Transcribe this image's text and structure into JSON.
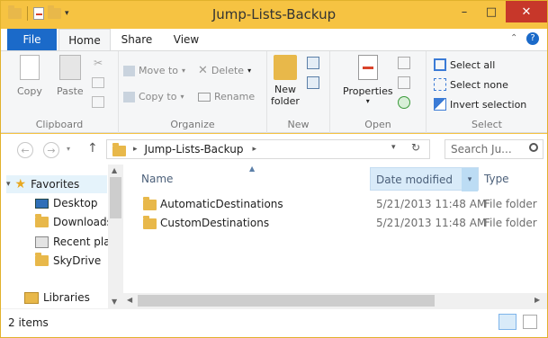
{
  "window": {
    "title": "Jump-Lists-Backup",
    "accent": "#f6c342"
  },
  "window_controls": {
    "minimize": "–",
    "maximize": "□",
    "close": "✕"
  },
  "ribbon_tabs": [
    {
      "label": "File"
    },
    {
      "label": "Home"
    },
    {
      "label": "Share"
    },
    {
      "label": "View"
    }
  ],
  "ribbon": {
    "clipboard": {
      "copy": "Copy",
      "paste": "Paste",
      "label": "Clipboard"
    },
    "organize": {
      "move_to": "Move to",
      "copy_to": "Copy to",
      "delete": "Delete",
      "rename": "Rename",
      "label": "Organize"
    },
    "new": {
      "new_folder_line1": "New",
      "new_folder_line2": "folder",
      "label": "New"
    },
    "open": {
      "properties": "Properties",
      "label": "Open"
    },
    "select": {
      "select_all": "Select all",
      "select_none": "Select none",
      "invert": "Invert selection",
      "label": "Select"
    }
  },
  "address": {
    "path": "Jump-Lists-Backup",
    "search_placeholder": "Search Ju..."
  },
  "navigation": {
    "favorites": "Favorites",
    "items": [
      "Desktop",
      "Downloads",
      "Recent plac",
      "SkyDrive"
    ],
    "libraries": "Libraries"
  },
  "columns": {
    "name": "Name",
    "date": "Date modified",
    "type": "Type"
  },
  "files": [
    {
      "name": "AutomaticDestinations",
      "date": "5/21/2013 11:48 AM",
      "type": "File folder"
    },
    {
      "name": "CustomDestinations",
      "date": "5/21/2013 11:48 AM",
      "type": "File folder"
    }
  ],
  "status": {
    "count": "2 items"
  }
}
